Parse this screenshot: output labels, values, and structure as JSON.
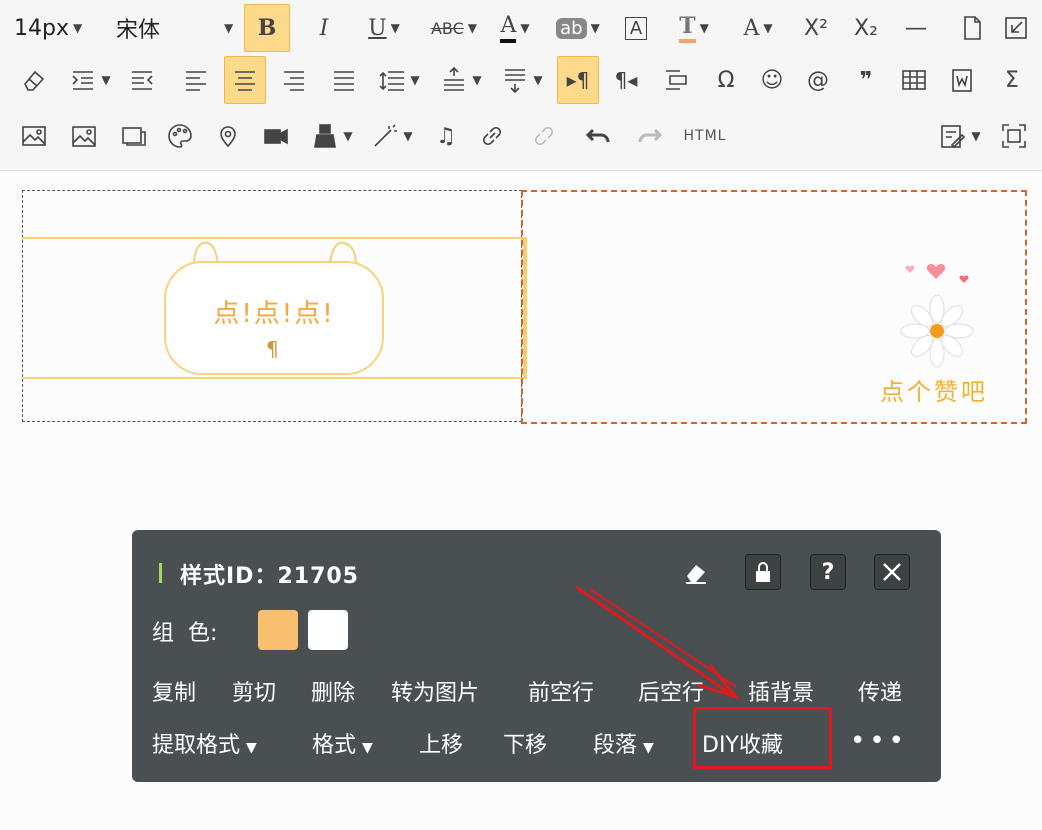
{
  "toolbar": {
    "font_size": "14px",
    "font_family": "宋体",
    "html_label": "HTML"
  },
  "editor": {
    "left_block_text": "点!点!点!",
    "pilcrow": "¶",
    "right_block_text": "点个赞吧"
  },
  "popup": {
    "title": "样式ID：21705",
    "color_label": "组  色:",
    "swatch_colors": [
      "#f8c06f",
      "#ffffff"
    ],
    "actions_row1": [
      "复制",
      "剪切",
      "删除",
      "转为图片",
      "前空行",
      "后空行",
      "插背景",
      "传递"
    ],
    "actions_row2": [
      "提取格式",
      "格式",
      "上移",
      "下移",
      "段落",
      "DIY收藏"
    ],
    "more": "•••"
  },
  "colors": {
    "popup_bg": "#4a5052",
    "highlight": "#e0191e",
    "accent": "#fdd98a"
  }
}
